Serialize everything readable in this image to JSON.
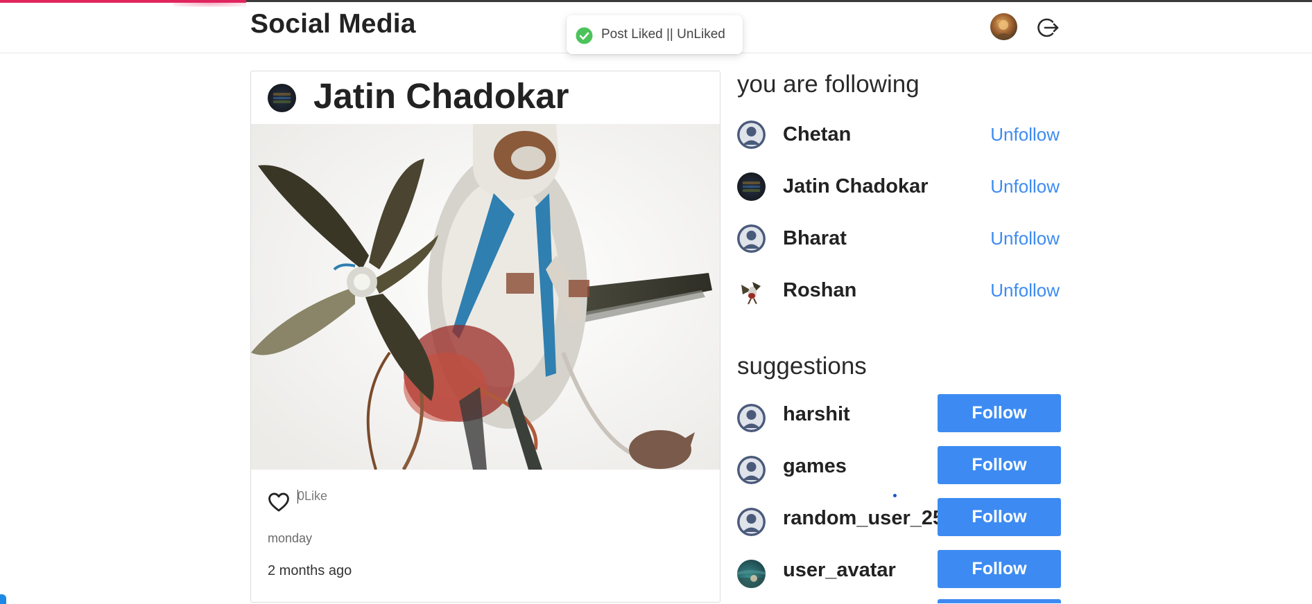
{
  "app": {
    "brand": "Social Media"
  },
  "toast": {
    "message": "Post Liked || UnLiked",
    "status": "success"
  },
  "post": {
    "author": "Jatin Chadokar",
    "like_count": "0",
    "like_label": "Like",
    "caption": "monday",
    "time_ago": "2 months ago",
    "liked": false
  },
  "following": {
    "title": "you are following",
    "action_label": "Unfollow",
    "users": [
      {
        "name": "Chetan"
      },
      {
        "name": "Jatin Chadokar"
      },
      {
        "name": "Bharat"
      },
      {
        "name": "Roshan"
      }
    ]
  },
  "suggestions": {
    "title": "suggestions",
    "action_label": "Follow",
    "users": [
      {
        "name": "harshit"
      },
      {
        "name": "games"
      },
      {
        "name": "random_user_25"
      },
      {
        "name": "user_avatar"
      }
    ]
  },
  "colors": {
    "accent": "#3d8bf2",
    "progress": "#e0245e",
    "toast_success": "#4cc35a"
  },
  "icons": {
    "logout": "logout-icon",
    "like": "heart-outline-icon",
    "toast": "check-circle-icon",
    "default_avatar": "default-user-avatar-icon"
  }
}
